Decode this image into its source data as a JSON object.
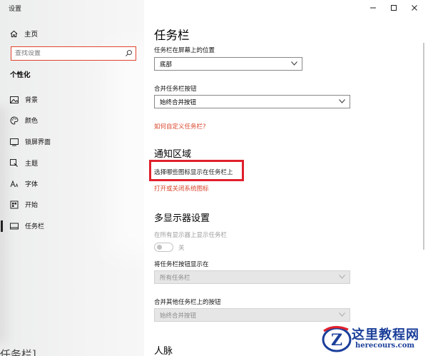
{
  "window": {
    "title": "设置"
  },
  "sidebar": {
    "home_label": "主页",
    "search_placeholder": "查找设置",
    "section_title": "个性化",
    "items": [
      {
        "label": "背景",
        "icon": "picture-icon"
      },
      {
        "label": "颜色",
        "icon": "palette-icon"
      },
      {
        "label": "锁屏界面",
        "icon": "lock-screen-icon"
      },
      {
        "label": "主题",
        "icon": "brush-icon"
      },
      {
        "label": "字体",
        "icon": "font-icon"
      },
      {
        "label": "开始",
        "icon": "start-icon"
      },
      {
        "label": "任务栏",
        "icon": "taskbar-icon",
        "active": true
      }
    ],
    "bottom_text": "[任务栏]"
  },
  "main": {
    "title": "任务栏",
    "position_label": "任务栏在屏幕上的位置",
    "position_value": "底部",
    "combine_label": "合并任务栏按钮",
    "combine_value": "始终合并按钮",
    "customize_link": "如何自定义任务栏?",
    "notification_title": "通知区域",
    "select_icons_link": "选择哪些图标显示在任务栏上",
    "system_icons_link": "打开或关闭系统图标",
    "multi_display_title": "多显示器设置",
    "show_all_label": "在所有显示器上显示任务栏",
    "toggle_state": "关",
    "show_buttons_label": "将任务栏按钮显示在",
    "show_buttons_value": "所有任务栏",
    "combine_other_label": "合并其他任务栏上的按钮",
    "combine_other_value": "始终合并按钮",
    "people_title": "人脉"
  },
  "watermark": {
    "name": "这里教程网",
    "url": "herecours.com",
    "badge_letter": "Z"
  },
  "colors": {
    "link": "#d9442a",
    "highlight": "#e0202c",
    "search_border": "#e0432b",
    "watermark": "#1b3f9a"
  }
}
